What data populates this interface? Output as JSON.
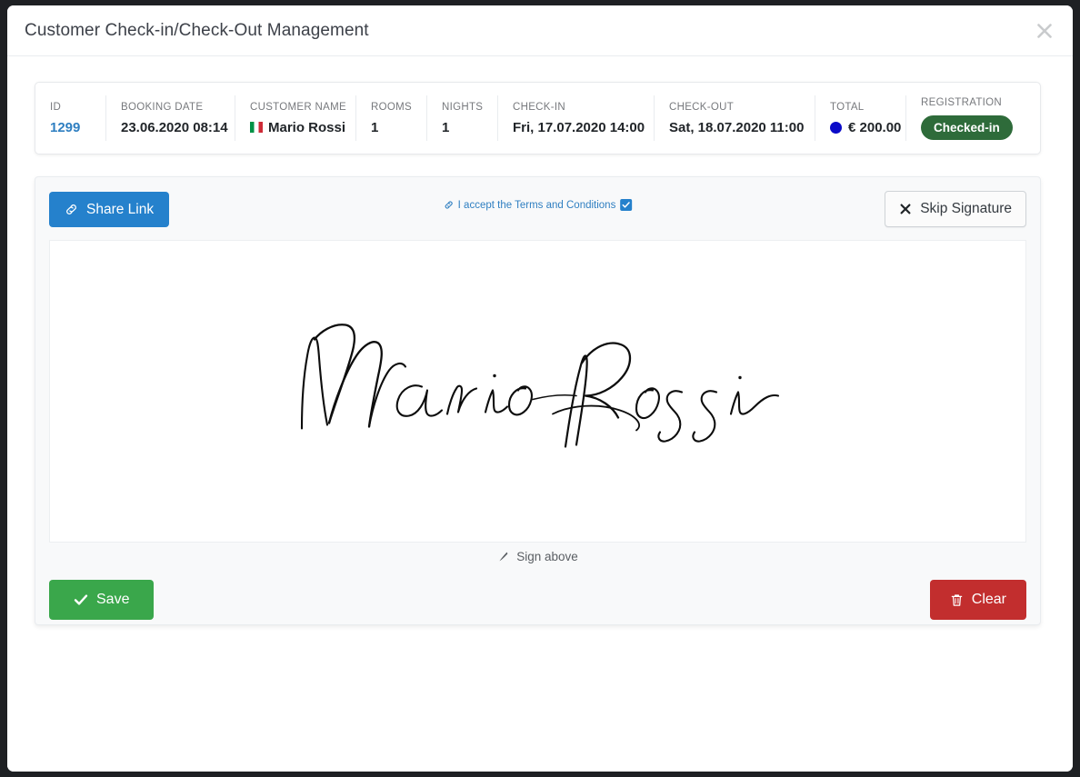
{
  "modal": {
    "title": "Customer Check-in/Check-Out Management",
    "close_icon": "close-icon"
  },
  "info_bar": {
    "columns": [
      {
        "label": "ID",
        "value": "1299",
        "style": "link"
      },
      {
        "label": "BOOKING DATE",
        "value": "23.06.2020 08:14",
        "style": "text"
      },
      {
        "label": "CUSTOMER NAME",
        "value": "Mario Rossi",
        "style": "flag",
        "flag": "italy-flag-icon"
      },
      {
        "label": "ROOMS",
        "value": "1",
        "style": "text"
      },
      {
        "label": "NIGHTS",
        "value": "1",
        "style": "text"
      },
      {
        "label": "CHECK-IN",
        "value": "Fri, 17.07.2020 14:00",
        "style": "text"
      },
      {
        "label": "CHECK-OUT",
        "value": "Sat, 18.07.2020 11:00",
        "style": "text"
      },
      {
        "label": "TOTAL",
        "value": "€ 200.00",
        "style": "dot",
        "dot_color": "#0b0bc8"
      },
      {
        "label": "REGISTRATION",
        "value": "Checked-in",
        "style": "badge",
        "badge_color": "#2e6b3a"
      }
    ]
  },
  "signature_panel": {
    "share_link_label": "Share Link",
    "share_link_icon": "link-icon",
    "share_link_color": "#2581cc",
    "terms_label": "I accept the Terms and Conditions",
    "terms_icon": "link-icon",
    "terms_checked": true,
    "terms_color": "#2f7fc1",
    "skip_signature_label": "Skip Signature",
    "skip_signature_icon": "close-x-icon",
    "sign_above_label": "Sign above",
    "sign_above_icon": "pen-icon",
    "signature_value": "Mario Rossi",
    "save_label": "Save",
    "save_icon": "check-icon",
    "save_color": "#3aa74b",
    "clear_label": "Clear",
    "clear_icon": "trash-icon",
    "clear_color": "#c22e2e"
  }
}
